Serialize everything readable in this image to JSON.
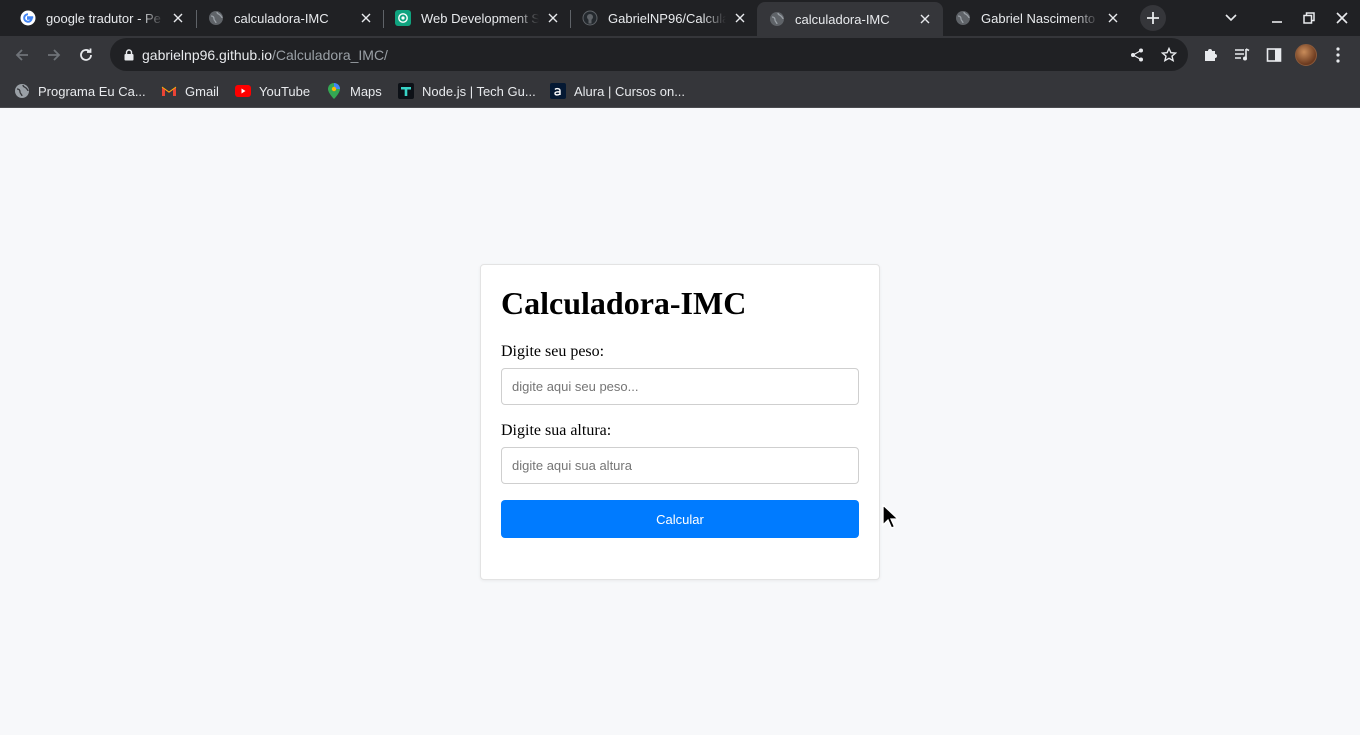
{
  "browser": {
    "tabs": [
      {
        "title": "google tradutor - Pe",
        "icon": "google-g-icon",
        "active": false
      },
      {
        "title": "calculadora-IMC",
        "icon": "globe-icon",
        "active": false
      },
      {
        "title": "Web Development S",
        "icon": "openai-icon",
        "active": false
      },
      {
        "title": "GabrielNP96/Calcula",
        "icon": "github-icon",
        "active": false
      },
      {
        "title": "calculadora-IMC",
        "icon": "globe-icon",
        "active": true
      },
      {
        "title": "Gabriel Nascimento",
        "icon": "globe-icon",
        "active": false
      }
    ],
    "url": {
      "host": "gabrielnp96.github.io",
      "path": "/Calculadora_IMC/"
    },
    "bookmarks": [
      {
        "label": "Programa Eu Ca...",
        "icon": "globe-icon"
      },
      {
        "label": "Gmail",
        "icon": "gmail-icon"
      },
      {
        "label": "YouTube",
        "icon": "youtube-icon"
      },
      {
        "label": "Maps",
        "icon": "maps-icon"
      },
      {
        "label": "Node.js | Tech Gu...",
        "icon": "techguide-icon"
      },
      {
        "label": "Alura | Cursos on...",
        "icon": "alura-icon"
      }
    ]
  },
  "page": {
    "title": "Calculadora-IMC",
    "weight": {
      "label": "Digite seu peso:",
      "placeholder": "digite aqui seu peso...",
      "value": ""
    },
    "height": {
      "label": "Digite sua altura:",
      "placeholder": "digite aqui sua altura",
      "value": ""
    },
    "button_label": "Calcular"
  },
  "colors": {
    "accent": "#007bff",
    "page_background": "#f7f8fa",
    "chrome_dark": "#202124",
    "chrome_toolbar": "#35363a"
  }
}
